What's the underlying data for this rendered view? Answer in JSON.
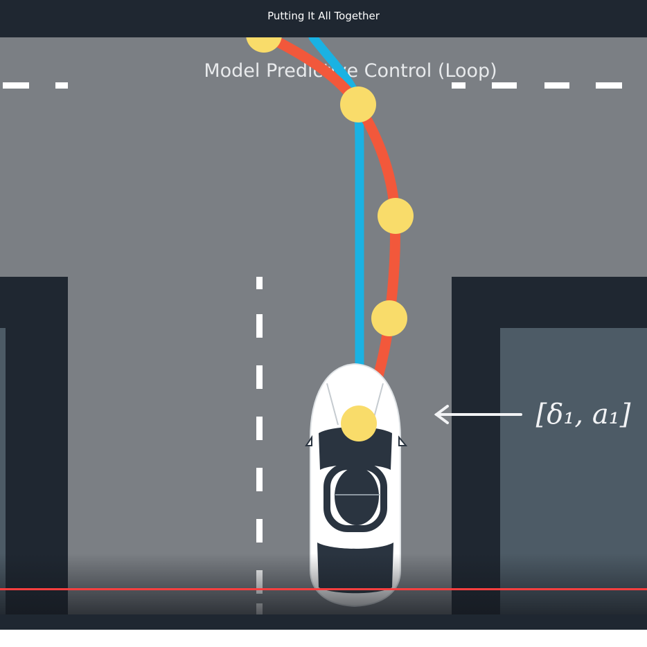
{
  "video": {
    "title": "Putting It All Together",
    "progress": 1.0
  },
  "scene": {
    "heading": "Model Predictive Control (Loop)",
    "actuator_label": "[δ₁, a₁]",
    "colors": {
      "road": "#7b7f84",
      "building_dark": "#1f2731",
      "building_light": "#4d5b66",
      "reference_line": "#1ab2e3",
      "predicted_path": "#f2583b",
      "waypoint": "#f9dc6a",
      "lane_marking": "#ffffff",
      "progress": "#ff3f3f"
    }
  }
}
